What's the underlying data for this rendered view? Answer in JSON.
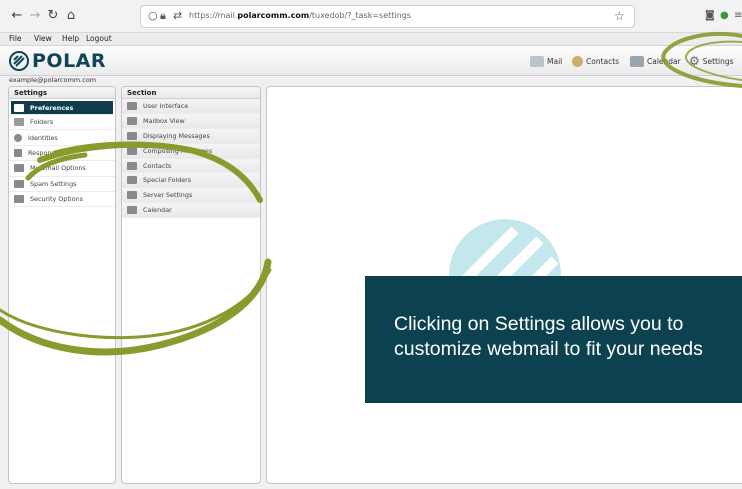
{
  "browser": {
    "url_prefix": "https://mail.",
    "url_domain": "polarcomm.com",
    "url_path": "/tuxedob/?_task=settings"
  },
  "menu": [
    "File",
    "View",
    "Help",
    "Logout"
  ],
  "header": {
    "logo_text": "POLAR",
    "nav": [
      {
        "label": "Mail",
        "icon": "mail-icon"
      },
      {
        "label": "Contacts",
        "icon": "contacts-icon"
      },
      {
        "label": "Calendar",
        "icon": "calendar-icon"
      },
      {
        "label": "Settings",
        "icon": "gear-icon"
      }
    ]
  },
  "user_email": "example@polarcomm.com",
  "settings_panel": {
    "title": "Settings",
    "items": [
      {
        "label": "Preferences",
        "icon": "monitor-icon",
        "active": true
      },
      {
        "label": "Folders",
        "icon": "folder-icon"
      },
      {
        "label": "Identities",
        "icon": "person-icon"
      },
      {
        "label": "Responses",
        "icon": "document-icon"
      },
      {
        "label": "My Email Options",
        "icon": "user-options-icon"
      },
      {
        "label": "Spam Settings",
        "icon": "spam-icon"
      },
      {
        "label": "Security Options",
        "icon": "security-icon"
      }
    ]
  },
  "section_panel": {
    "title": "Section",
    "items": [
      {
        "label": "User Interface",
        "icon": "monitor-icon"
      },
      {
        "label": "Mailbox View",
        "icon": "list-icon"
      },
      {
        "label": "Displaying Messages",
        "icon": "message-icon"
      },
      {
        "label": "Composing Messages",
        "icon": "compose-icon"
      },
      {
        "label": "Contacts",
        "icon": "contacts-icon"
      },
      {
        "label": "Special Folders",
        "icon": "folder-icon"
      },
      {
        "label": "Server Settings",
        "icon": "server-icon"
      },
      {
        "label": "Calendar",
        "icon": "calendar-icon"
      }
    ]
  },
  "callout": {
    "line1": "Clicking on Settings allows you to",
    "line2": "customize webmail to fit your needs"
  },
  "colors": {
    "brand": "#0d4658",
    "active_row": "#0f3d4c",
    "callout_bg": "#0c4250",
    "annotation": "#8a9a2c",
    "watermark": "#8fd3dc"
  }
}
